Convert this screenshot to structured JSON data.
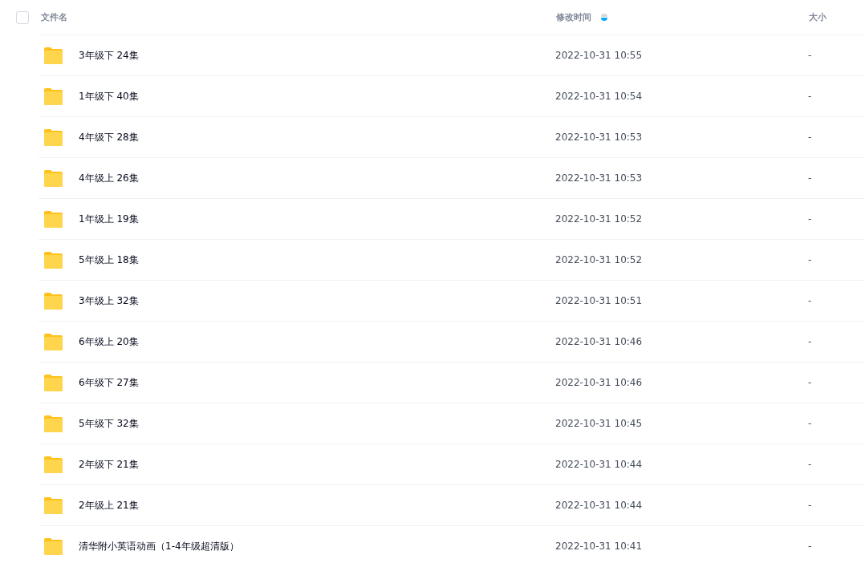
{
  "header": {
    "select_all": {
      "checked": false
    },
    "columns": [
      {
        "label": "文件名",
        "sorted": false
      },
      {
        "label": "修改时间",
        "sorted": true,
        "descending": true
      },
      {
        "label": "大小",
        "sorted": false
      }
    ]
  },
  "rows": [
    {
      "name": "3年级下 24集",
      "modified": "2022-10-31 10:55",
      "size": "-"
    },
    {
      "name": "1年级下 40集",
      "modified": "2022-10-31 10:54",
      "size": "-"
    },
    {
      "name": "4年级下 28集",
      "modified": "2022-10-31 10:53",
      "size": "-"
    },
    {
      "name": "4年级上 26集",
      "modified": "2022-10-31 10:53",
      "size": "-"
    },
    {
      "name": "1年级上 19集",
      "modified": "2022-10-31 10:52",
      "size": "-"
    },
    {
      "name": "5年级上 18集",
      "modified": "2022-10-31 10:52",
      "size": "-"
    },
    {
      "name": "3年级上 32集",
      "modified": "2022-10-31 10:51",
      "size": "-"
    },
    {
      "name": "6年级上 20集",
      "modified": "2022-10-31 10:46",
      "size": "-"
    },
    {
      "name": "6年级下 27集",
      "modified": "2022-10-31 10:46",
      "size": "-"
    },
    {
      "name": "5年级下 32集",
      "modified": "2022-10-31 10:45",
      "size": "-"
    },
    {
      "name": "2年级下 21集",
      "modified": "2022-10-31 10:44",
      "size": "-"
    },
    {
      "name": "2年级上 21集",
      "modified": "2022-10-31 10:44",
      "size": "-"
    },
    {
      "name": "清华附小英语动画（1-4年级超清版）",
      "modified": "2022-10-31 10:41",
      "size": "-"
    }
  ]
}
